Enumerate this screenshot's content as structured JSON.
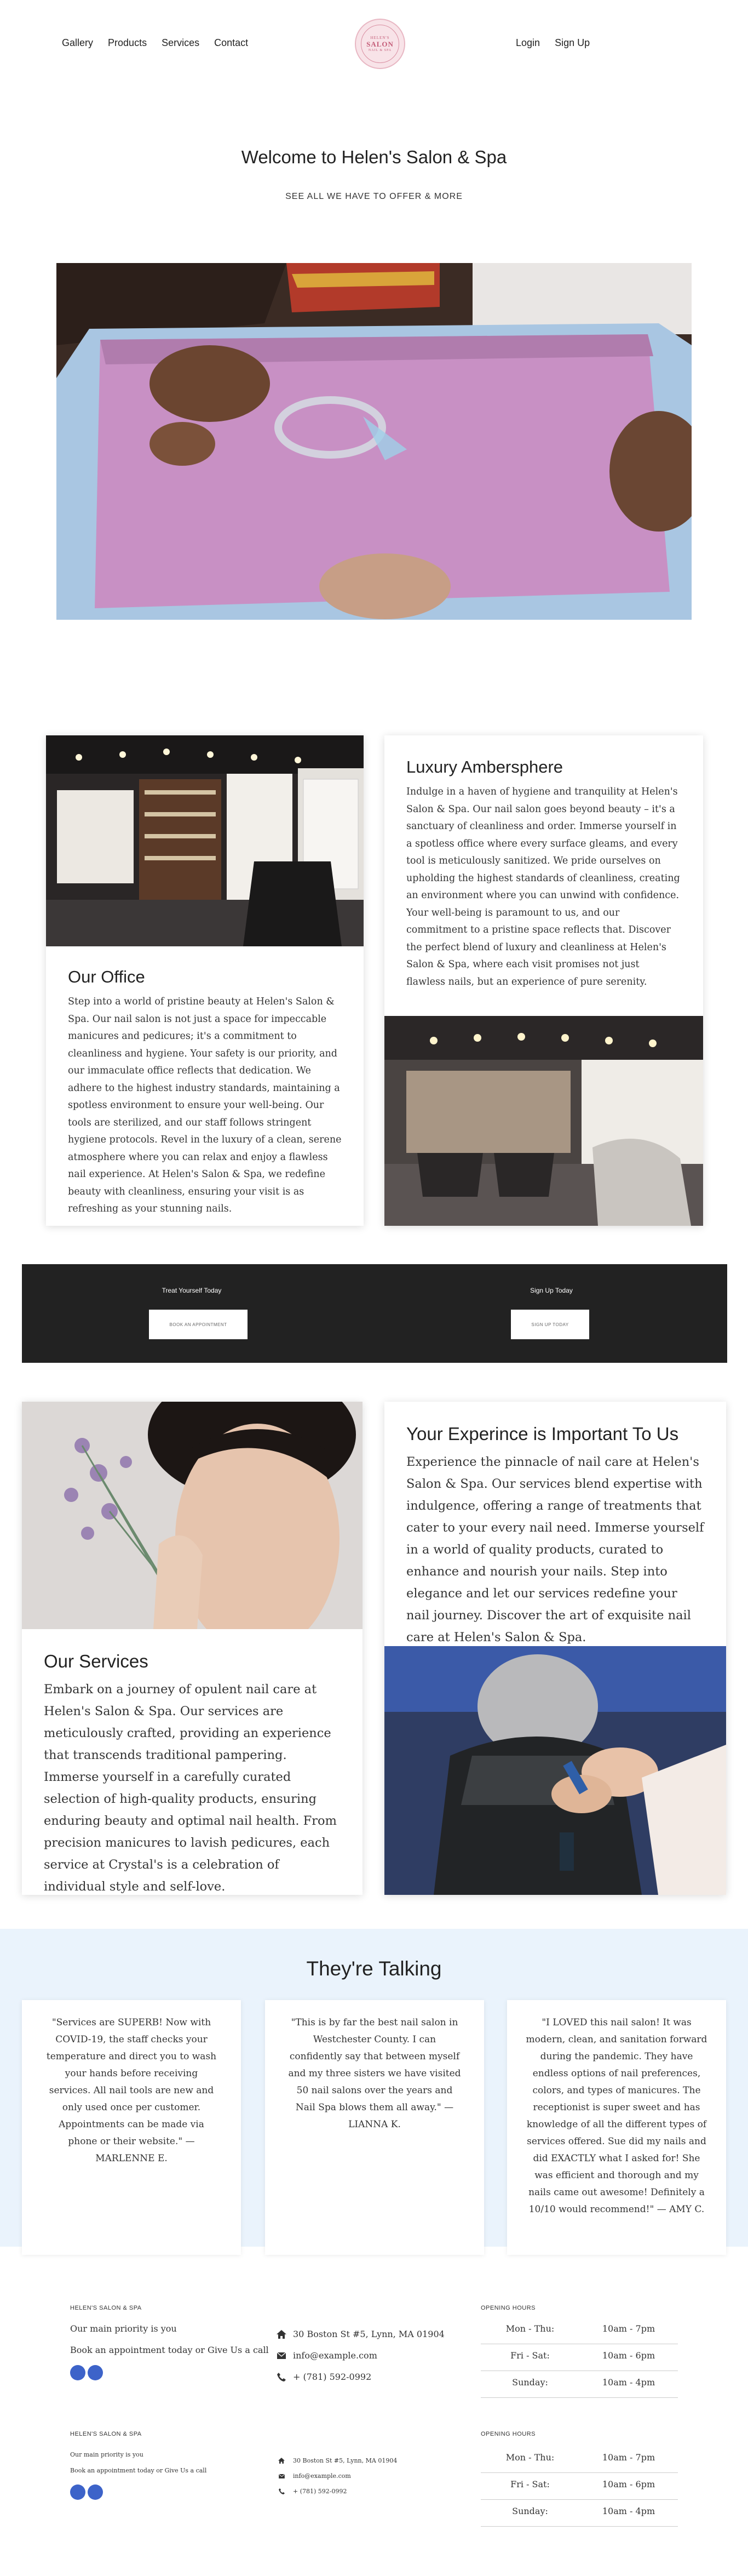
{
  "nav": {
    "left": [
      "Gallery",
      "Products",
      "Services",
      "Contact"
    ],
    "right": [
      "Login",
      "Sign Up"
    ]
  },
  "logo": {
    "line1": "HELEN'S",
    "line2": "SALON",
    "line3": "NAIL & SPA"
  },
  "hero": {
    "title": "Welcome to Helen's Salon & Spa",
    "cta": "SEE ALL WE HAVE TO OFFER & MORE"
  },
  "office": {
    "title": "Our Office",
    "body": "Step into a world of pristine beauty at Helen's Salon & Spa. Our nail salon is not just a space for impeccable manicures and pedicures; it's a commitment to cleanliness and hygiene. Your safety is our priority, and our immaculate office reflects that dedication. We adhere to the highest industry standards, maintaining a spotless environment to ensure your well-being. Our tools are sterilized, and our staff follows stringent hygiene protocols. Revel in the luxury of a clean, serene atmosphere where you can relax and enjoy a flawless nail experience. At Helen's Salon & Spa, we redefine beauty with cleanliness, ensuring your visit is as refreshing as your stunning nails."
  },
  "luxury": {
    "title": "Luxury Ambersphere",
    "body": "Indulge in a haven of hygiene and tranquility at Helen's Salon & Spa. Our nail salon goes beyond beauty – it's a sanctuary of cleanliness and order. Immerse yourself in a spotless office where every surface gleams, and every tool is meticulously sanitized. We pride ourselves on upholding the highest standards of cleanliness, creating an environment where you can unwind with confidence. Your well-being is paramount to us, and our commitment to a pristine space reflects that. Discover the perfect blend of luxury and cleanliness at Helen's Salon & Spa, where each visit promises not just flawless nails, but an experience of pure serenity."
  },
  "cta_band": {
    "left_label": "Treat Yourself Today",
    "left_button": "BOOK AN APPOINTMENT",
    "right_label": "Sign Up Today",
    "right_button": "SIGN UP TODAY"
  },
  "experience": {
    "title": "Your Experince is Important To Us",
    "body": "Experience the pinnacle of nail care at Helen's Salon & Spa. Our services blend expertise with indulgence, offering a range of treatments that cater to your every nail need. Immerse yourself in a world of quality products, curated to enhance and nourish your nails. Step into elegance and let our services redefine your nail journey. Discover the art of exquisite nail care at Helen's Salon & Spa."
  },
  "services": {
    "title": "Our Services",
    "body": "Embark on a journey of opulent nail care at Helen's Salon & Spa. Our services are meticulously crafted, providing an experience that transcends traditional pampering. Immerse yourself in a carefully curated selection of high-quality products, ensuring enduring beauty and optimal nail health. From precision manicures to lavish pedicures, each service at Crystal's is a celebration of individual style and self-love."
  },
  "testimonials": {
    "title": "They're Talking",
    "items": [
      "\"Services are SUPERB! Now with COVID-19, the staff checks your temperature and direct you to wash your hands before receiving services. All nail tools are new and only used once per customer. Appointments can be made via phone or their website.\" — MARLENNE E.",
      "\"This is by far the best nail salon in Westchester County. I can confidently say that between myself and my three sisters we have visited 50 nail salons over the years and Nail Spa blows them all away.\" — LIANNA K.",
      "\"I LOVED this nail salon! It was modern, clean, and sanitation forward during the pandemic. They have endless options of nail preferences, colors, and types of manicures. The receptionist is super sweet and has knowledge of all the different types of services offered. Sue did my nails and did EXACTLY what I asked for! She was efficient and thorough and my nails came out awesome! Definitely a 10/10 would recommend!\" — AMY C."
    ]
  },
  "footer": {
    "brand": "HELEN'S SALON & SPA",
    "tagline": "Our main priority is you",
    "book": "Book an appointment today or Give Us a call",
    "address": "30 Boston St #5, Lynn, MA 01904",
    "email": "info@example.com",
    "phone": "+ (781) 592-0992",
    "hours_title": "OPENING HOURS",
    "hours": [
      {
        "day": "Mon - Thu:",
        "time": "10am - 7pm"
      },
      {
        "day": "Fri - Sat:",
        "time": "10am - 6pm"
      },
      {
        "day": "Sunday:",
        "time": "10am - 4pm"
      }
    ]
  },
  "colors": {
    "cta_band": "#222222",
    "testimonial_bg": "#eaf3fc",
    "social": "#3d63c9",
    "towel": "#c890c4"
  }
}
